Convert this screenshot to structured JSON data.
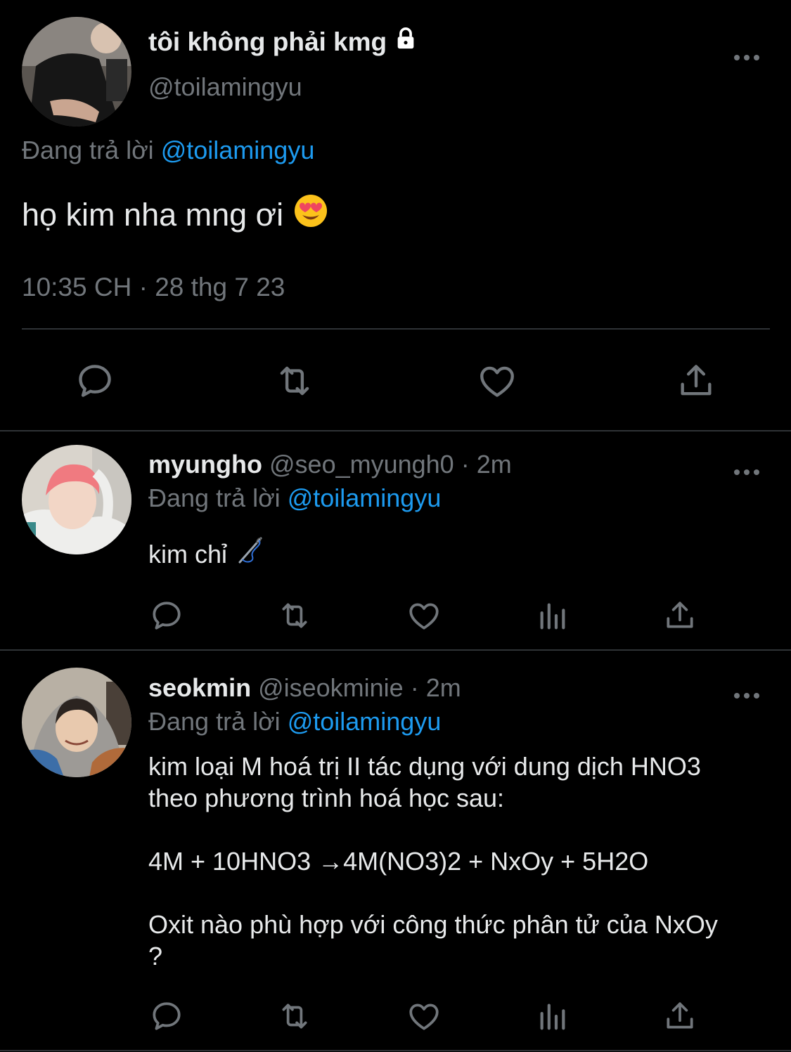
{
  "main_tweet": {
    "display_name": "tôi không phải kmg",
    "lock_icon": "lock-icon",
    "handle": "@toilamingyu",
    "replying_prefix": "Đang trả lời",
    "replying_to": "@toilamingyu",
    "text": "họ kim nha mng ơi",
    "emoji": "heart-eyes-emoji",
    "timestamp": "10:35 CH · 28 thg 7 23",
    "more_label": "•••",
    "actions": [
      "reply-icon",
      "retweet-icon",
      "like-icon",
      "share-icon"
    ]
  },
  "replies": [
    {
      "display_name": "myungho",
      "handle": "@seo_myungh0",
      "time": "2m",
      "separator": "·",
      "replying_prefix": "Đang trả lời",
      "replying_to": "@toilamingyu",
      "text": "kim chỉ",
      "emoji": "needle-thread-emoji",
      "more_label": "•••",
      "actions": [
        "reply-icon",
        "retweet-icon",
        "like-icon",
        "views-icon",
        "share-icon"
      ]
    },
    {
      "display_name": "seokmin",
      "handle": "@iseokminie",
      "time": "2m",
      "separator": "·",
      "replying_prefix": "Đang trả lời",
      "replying_to": "@toilamingyu",
      "text_lines": [
        "kim loại M hoá trị II tác dụng với dung dịch HNO3 theo phương trình hoá học sau:",
        "4M + 10HNO3 →4M(NO3)2 + NxOy + 5H2O",
        "Oxit nào phù hợp với công thức phân tử của NxOy ?"
      ],
      "more_label": "•••",
      "actions": [
        "reply-icon",
        "retweet-icon",
        "like-icon",
        "views-icon",
        "share-icon"
      ]
    }
  ],
  "colors": {
    "background": "#000000",
    "text_primary": "#e7e9ea",
    "text_secondary": "#71767b",
    "accent": "#1d9bf0",
    "divider": "#2f3336"
  }
}
